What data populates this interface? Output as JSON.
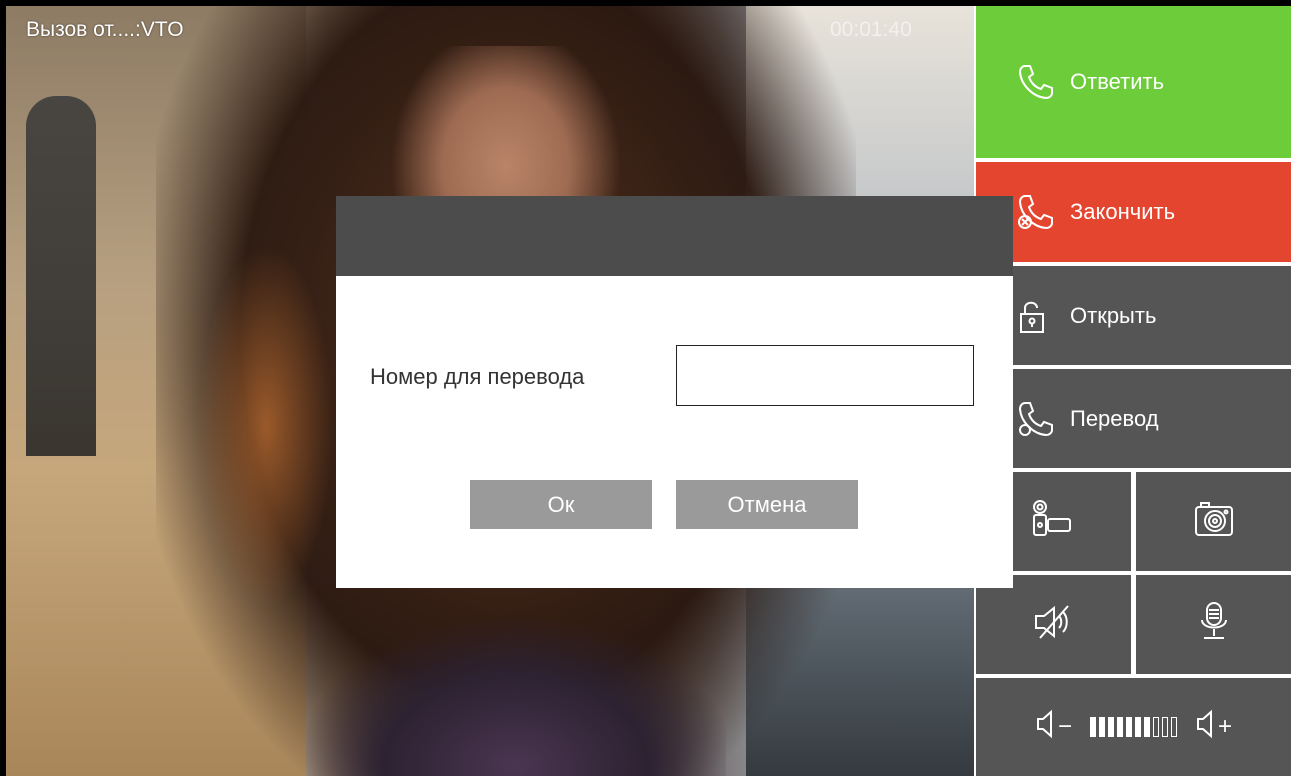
{
  "call": {
    "caption": "Вызов от....:VTO",
    "timer": "00:01:40"
  },
  "panel": {
    "answer_label": "Ответить",
    "end_label": "Закончить",
    "open_label": "Открыть",
    "transfer_label": "Перевод",
    "icons": {
      "answer": "phone-icon",
      "end": "phone-hangup-icon",
      "open": "unlock-icon",
      "transfer": "phone-transfer-icon",
      "video": "video-record-icon",
      "snapshot": "camera-icon",
      "speaker": "speaker-mute-icon",
      "mic": "microphone-icon",
      "vol_down": "volume-down-icon",
      "vol_up": "volume-up-icon"
    },
    "volume": {
      "minus": "−",
      "plus": "+",
      "level": 7,
      "max": 10
    },
    "colors": {
      "answer": "#6ccc3a",
      "end": "#e4452f",
      "tile": "#555555"
    }
  },
  "dialog": {
    "field_label": "Номер для перевода",
    "field_value": "",
    "ok_label": "Ок",
    "cancel_label": "Отмена"
  }
}
